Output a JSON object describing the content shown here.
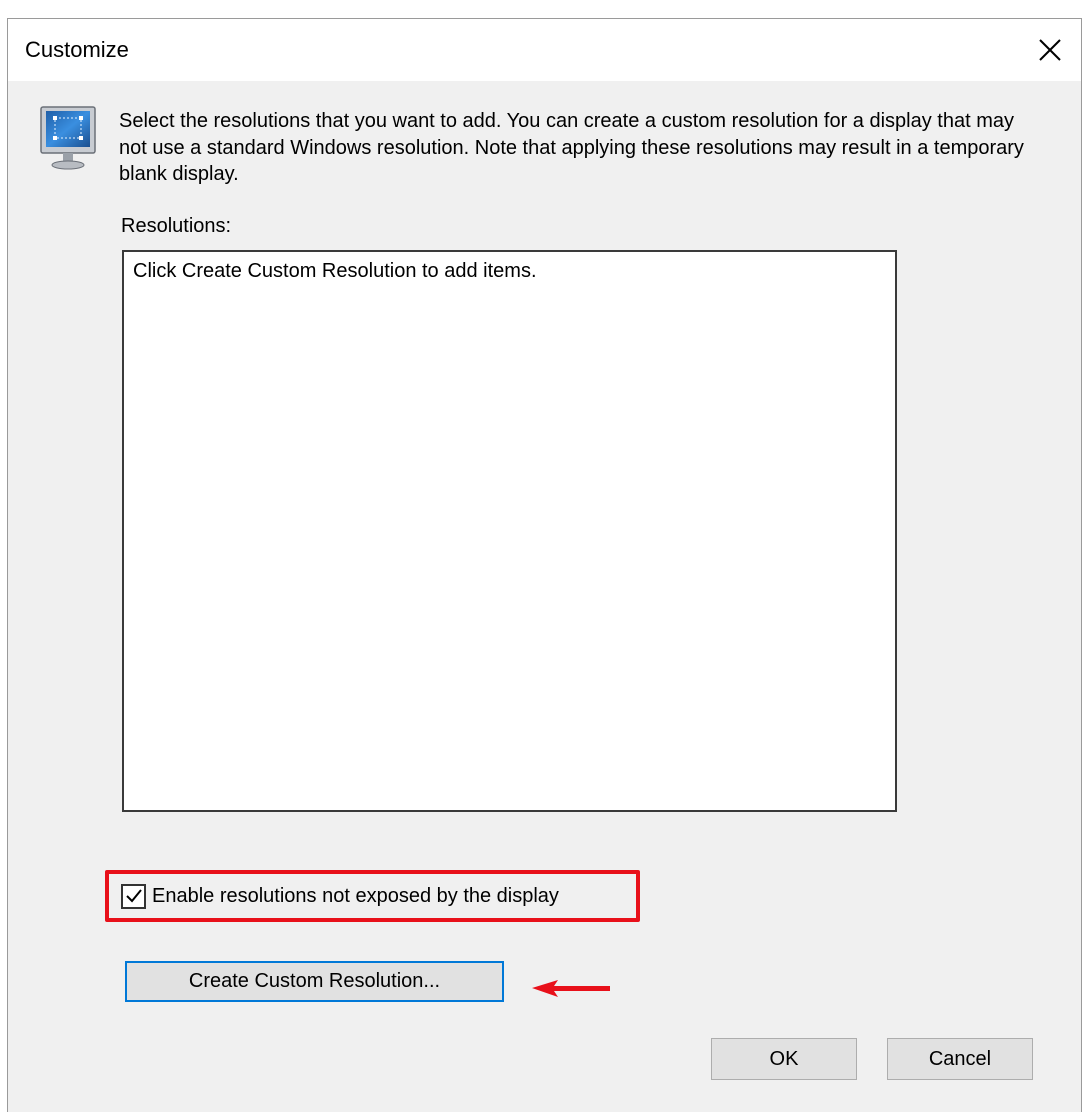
{
  "dialog": {
    "title": "Customize",
    "close_icon": "close-icon",
    "icon": "monitor-icon",
    "description": "Select the resolutions that you want to add. You can create a custom resolution for a display that may not use a standard Windows resolution. Note that applying these resolutions may result in a temporary blank display."
  },
  "resolutions": {
    "label": "Resolutions:",
    "empty_text": "Click Create Custom Resolution to add items."
  },
  "options": {
    "enable_label": "Enable resolutions not exposed by the display",
    "enable_checked": true
  },
  "buttons": {
    "create_custom": "Create Custom Resolution...",
    "ok": "OK",
    "cancel": "Cancel"
  },
  "annotations": {
    "highlight_color": "#e8101a",
    "arrow_color": "#e8101a"
  }
}
